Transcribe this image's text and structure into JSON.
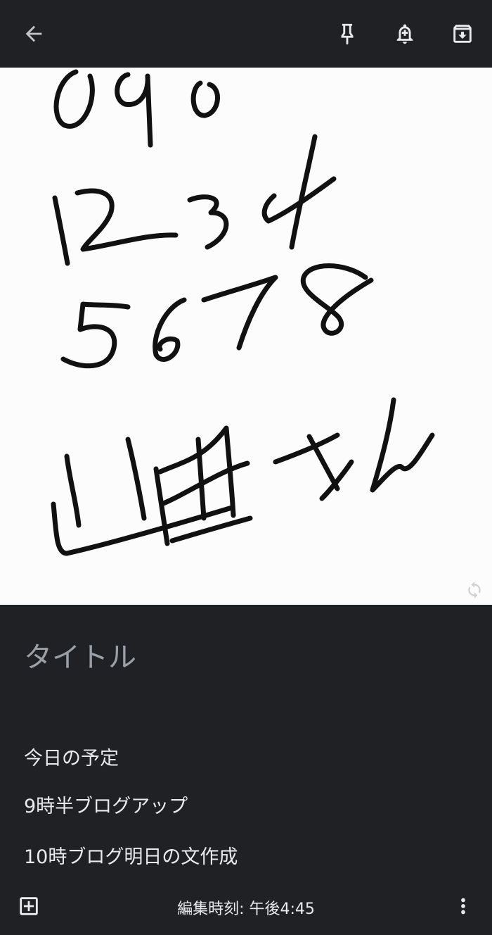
{
  "toolbar": {
    "back_icon": "arrow-back-icon",
    "pin_icon": "pin-icon",
    "reminder_icon": "add-reminder-bell-icon",
    "archive_icon": "archive-icon"
  },
  "drawing": {
    "handwritten_text": [
      "090",
      "1234",
      "5678",
      "山田さん"
    ],
    "sync_icon": "sync-icon"
  },
  "note": {
    "title_placeholder": "タイトル",
    "lines": [
      "今日の予定",
      "9時半ブログアップ",
      "10時ブログ明日の文作成"
    ]
  },
  "bottombar": {
    "add_icon": "add-box-icon",
    "edited_label": "編集時刻: 午後4:45",
    "more_icon": "more-vert-icon"
  },
  "colors": {
    "background": "#202124",
    "canvas": "#fcfcfc",
    "ink": "#111111",
    "icon": "#e8eaed",
    "placeholder": "#9aa0a6"
  }
}
